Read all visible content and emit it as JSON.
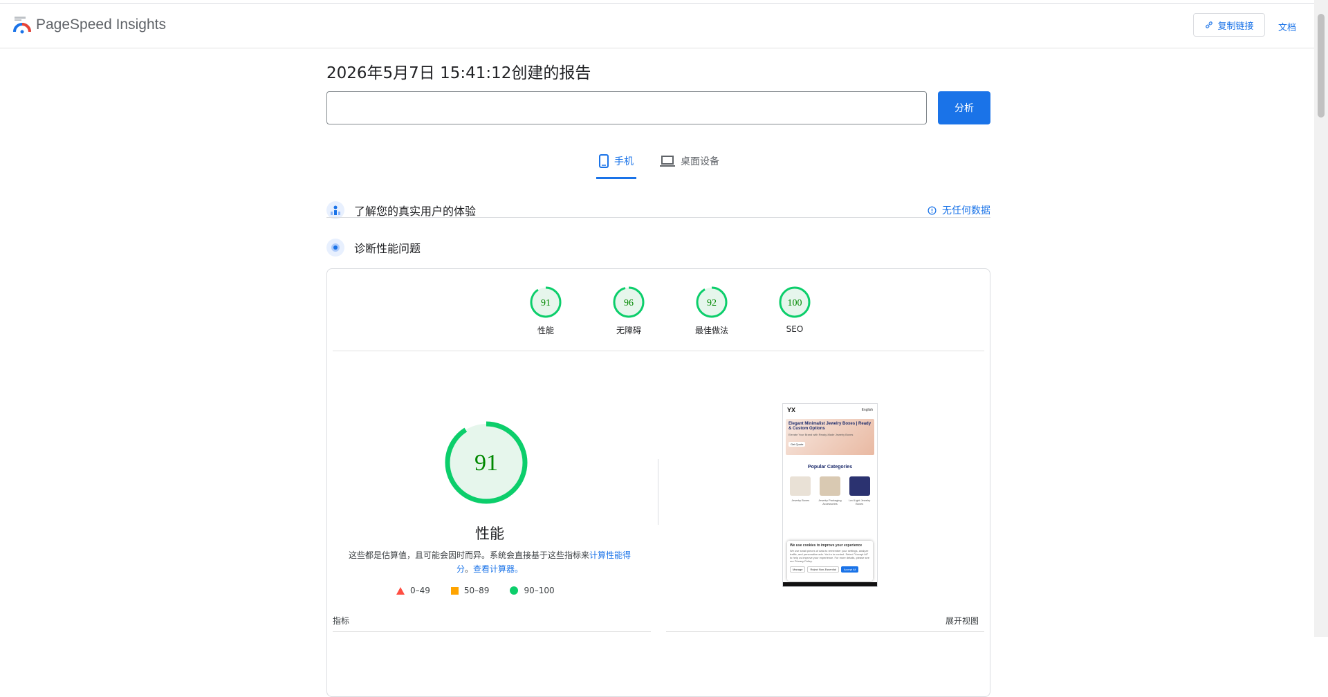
{
  "header": {
    "brand": "PageSpeed Insights",
    "copy_link": "复制链接",
    "docs": "文档"
  },
  "report": {
    "title": "2026年5月7日 15:41:12创建的报告",
    "url_value": "",
    "analyze": "分析"
  },
  "tabs": [
    {
      "label": "手机",
      "icon": "phone-icon",
      "active": true
    },
    {
      "label": "桌面设备",
      "icon": "laptop-icon",
      "active": false
    }
  ],
  "field_section": {
    "title": "了解您的真实用户的体验",
    "no_data": "无任何数据"
  },
  "lab_section": {
    "title": "诊断性能问题"
  },
  "scores": [
    {
      "label": "性能",
      "value": 91
    },
    {
      "label": "无障碍",
      "value": 96
    },
    {
      "label": "最佳做法",
      "value": 92
    },
    {
      "label": "SEO",
      "value": 100
    }
  ],
  "performance": {
    "score": 91,
    "title": "性能",
    "desc_prefix": "这些都是估算值，且可能会因时而异。系统会直接基于这些指标来",
    "desc_link1": "计算性能得分",
    "desc_mid": "。",
    "desc_link2": "查看计算器。",
    "legend": [
      {
        "range": "0–49"
      },
      {
        "range": "50–89"
      },
      {
        "range": "90–100"
      }
    ]
  },
  "screenshot": {
    "logo": "YX",
    "lang": "English",
    "hero_title": "Elegant Minimalist Jewelry Boxes | Ready & Custom Options",
    "hero_sub": "Elevate Your Brand with Ready-Made Jewelry Boxes",
    "hero_btn": "Get Quote",
    "popular": "Popular Categories",
    "categories": [
      "Jewelry Boxes",
      "Jewelry Packaging Accessories",
      "Led Light Jewelry Boxes"
    ],
    "cookie_title": "We use cookies to improve your experience",
    "cookie_text": "We use small pieces of data to remember your settings, analyze traffic, and personalize ads. You're in control. Select \"Accept All\" to help us improve your experience. For more details, please see our Privacy Policy.",
    "cookie_manage": "Manage",
    "cookie_reject": "Reject Non-Essential",
    "cookie_accept": "Accept All"
  },
  "metrics": {
    "label": "指标",
    "expand": "展开视图"
  },
  "colors": {
    "accent": "#1a73e8",
    "pass": "#0cce6b",
    "average": "#ffa400",
    "fail": "#ff4e42",
    "pass_text": "#008800",
    "pass_fill": "#e6f6ec"
  }
}
